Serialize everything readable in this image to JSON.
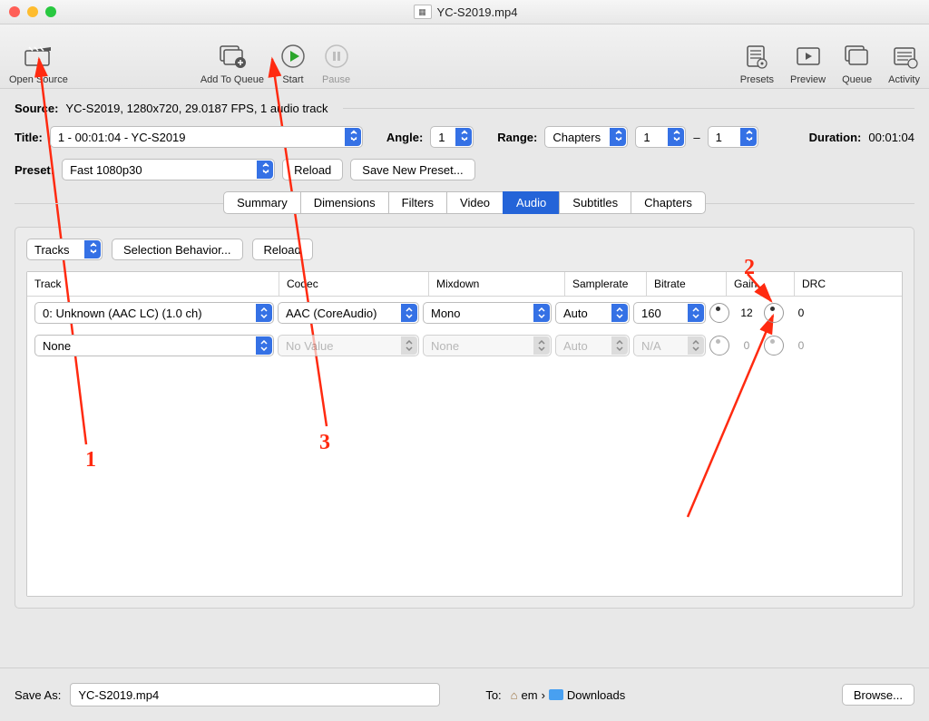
{
  "window": {
    "filename": "YC-S2019.mp4"
  },
  "toolbar": {
    "open_source": "Open Source",
    "add_to_queue": "Add To Queue",
    "start": "Start",
    "pause": "Pause",
    "presets": "Presets",
    "preview": "Preview",
    "queue": "Queue",
    "activity": "Activity"
  },
  "source": {
    "label": "Source:",
    "value": "YC-S2019, 1280x720, 29.0187 FPS, 1 audio track"
  },
  "title": {
    "label": "Title:",
    "value": "1 - 00:01:04 - YC-S2019"
  },
  "angle": {
    "label": "Angle:",
    "value": "1"
  },
  "range": {
    "label": "Range:",
    "mode": "Chapters",
    "from": "1",
    "to": "1",
    "separator": "–"
  },
  "duration": {
    "label": "Duration:",
    "value": "00:01:04"
  },
  "preset": {
    "label": "Preset:",
    "value": "Fast 1080p30",
    "reload": "Reload",
    "save_new": "Save New Preset..."
  },
  "tabs": {
    "summary": "Summary",
    "dimensions": "Dimensions",
    "filters": "Filters",
    "video": "Video",
    "audio": "Audio",
    "subtitles": "Subtitles",
    "chapters": "Chapters"
  },
  "audio_panel": {
    "tracks_btn": "Tracks",
    "selection_behavior": "Selection Behavior...",
    "reload": "Reload",
    "columns": {
      "track": "Track",
      "codec": "Codec",
      "mixdown": "Mixdown",
      "samplerate": "Samplerate",
      "bitrate": "Bitrate",
      "gain": "Gain",
      "drc": "DRC"
    },
    "rows": [
      {
        "track": "0: Unknown (AAC LC) (1.0 ch)",
        "codec": "AAC (CoreAudio)",
        "mixdown": "Mono",
        "samplerate": "Auto",
        "bitrate": "160",
        "gain": "12",
        "drc": "0",
        "enabled": true
      },
      {
        "track": "None",
        "codec": "No Value",
        "mixdown": "None",
        "samplerate": "Auto",
        "bitrate": "N/A",
        "gain": "0",
        "drc": "0",
        "enabled": false
      }
    ]
  },
  "footer": {
    "save_as_label": "Save As:",
    "save_as_value": "YC-S2019.mp4",
    "to_label": "To:",
    "path_home": "em",
    "path_folder": "Downloads",
    "browse": "Browse..."
  },
  "annotations": {
    "n1": "1",
    "n2": "2",
    "n3": "3"
  }
}
